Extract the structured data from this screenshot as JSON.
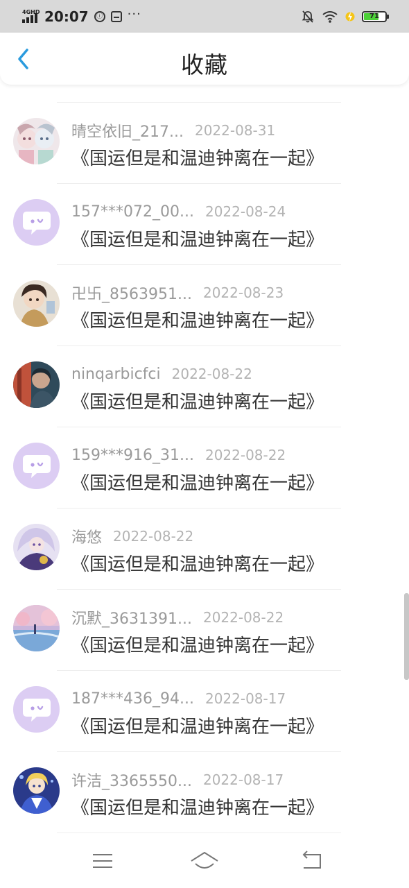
{
  "status_bar": {
    "network": "4GHD",
    "time": "20:07",
    "battery_level": 71,
    "battery_label": "71",
    "icons": [
      "signal-icon",
      "vpn-icon",
      "sim-card-icon",
      "more-dots-icon",
      "mute-bell-icon",
      "wifi-icon",
      "charging-icon",
      "battery-icon"
    ],
    "dots": "···"
  },
  "header": {
    "title": "收藏",
    "back_icon": "chevron-left-icon",
    "accent_color": "#2a9bde"
  },
  "favorites": [
    {
      "username": "晴空依旧_217...",
      "date": "2022-08-31",
      "title": "《国运但是和温迪钟离在一起》",
      "avatar": "anime-avatar-1"
    },
    {
      "username": "157***072_00...",
      "date": "2022-08-24",
      "title": "《国运但是和温迪钟离在一起》",
      "avatar": "default-chat-avatar"
    },
    {
      "username": "卍卐_8563951...",
      "date": "2022-08-23",
      "title": "《国运但是和温迪钟离在一起》",
      "avatar": "anime-avatar-2"
    },
    {
      "username": "ninqarbicfci",
      "date": "2022-08-22",
      "title": "《国运但是和温迪钟离在一起》",
      "avatar": "anime-avatar-3"
    },
    {
      "username": "159***916_31...",
      "date": "2022-08-22",
      "title": "《国运但是和温迪钟离在一起》",
      "avatar": "default-chat-avatar"
    },
    {
      "username": "海悠",
      "date": "2022-08-22",
      "title": "《国运但是和温迪钟离在一起》",
      "avatar": "anime-avatar-4"
    },
    {
      "username": "沉默_3631391...",
      "date": "2022-08-22",
      "title": "《国运但是和温迪钟离在一起》",
      "avatar": "landscape-avatar"
    },
    {
      "username": "187***436_94...",
      "date": "2022-08-17",
      "title": "《国运但是和温迪钟离在一起》",
      "avatar": "default-chat-avatar"
    },
    {
      "username": "许洁_3365550...",
      "date": "2022-08-17",
      "title": "《国运但是和温迪钟离在一起》",
      "avatar": "anime-avatar-5"
    }
  ],
  "nav_bar": {
    "icons": [
      "menu-icon",
      "home-icon",
      "back-icon"
    ]
  }
}
